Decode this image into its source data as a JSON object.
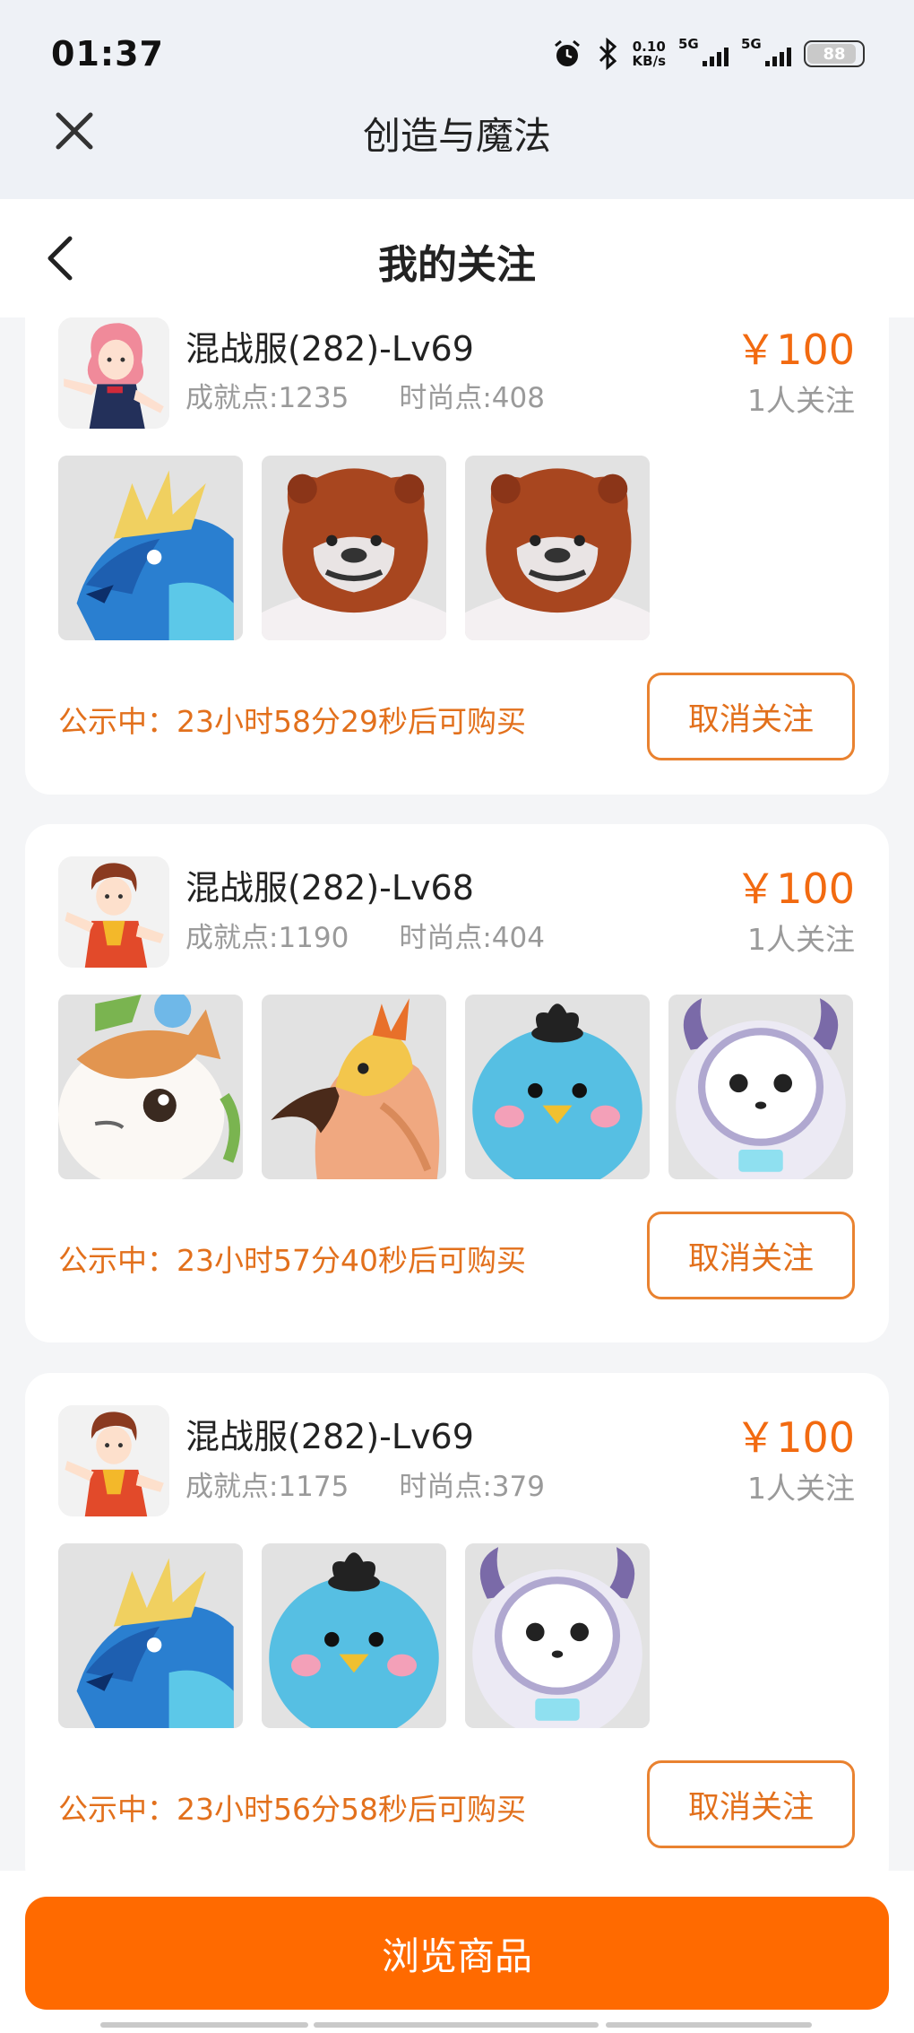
{
  "status_bar": {
    "time": "01:37",
    "net_speed_value": "0.10",
    "net_speed_unit": "KB/s",
    "signal1_label": "5G",
    "signal2_label": "5G",
    "battery": "88"
  },
  "app": {
    "title": "创造与魔法"
  },
  "nav": {
    "title": "我的关注"
  },
  "items": [
    {
      "server": "混战服(282)-Lv69",
      "achievement": "成就点:1235",
      "fashion": "时尚点:408",
      "price": "￥100",
      "followers": "1人关注",
      "pets": [
        "blue-dragon",
        "brown-bear",
        "brown-bear"
      ],
      "countdown": "公示中：23小时58分29秒后可购买",
      "unfollow_label": "取消关注"
    },
    {
      "server": "混战服(282)-Lv68",
      "achievement": "成就点:1190",
      "fashion": "时尚点:404",
      "price": "￥100",
      "followers": "1人关注",
      "pets": [
        "calico-cat",
        "golden-parrot",
        "blue-bird",
        "white-astronaut"
      ],
      "countdown": "公示中：23小时57分40秒后可购买",
      "unfollow_label": "取消关注"
    },
    {
      "server": "混战服(282)-Lv69",
      "achievement": "成就点:1175",
      "fashion": "时尚点:379",
      "price": "￥100",
      "followers": "1人关注",
      "pets": [
        "blue-dragon",
        "blue-bird",
        "white-astronaut"
      ],
      "countdown": "公示中：23小时56分58秒后可购买",
      "unfollow_label": "取消关注"
    }
  ],
  "bottom": {
    "browse_label": "浏览商品"
  },
  "colors": {
    "accent": "#ff6a00",
    "countdown_text": "#e2701c",
    "price_text": "#f26a10"
  }
}
